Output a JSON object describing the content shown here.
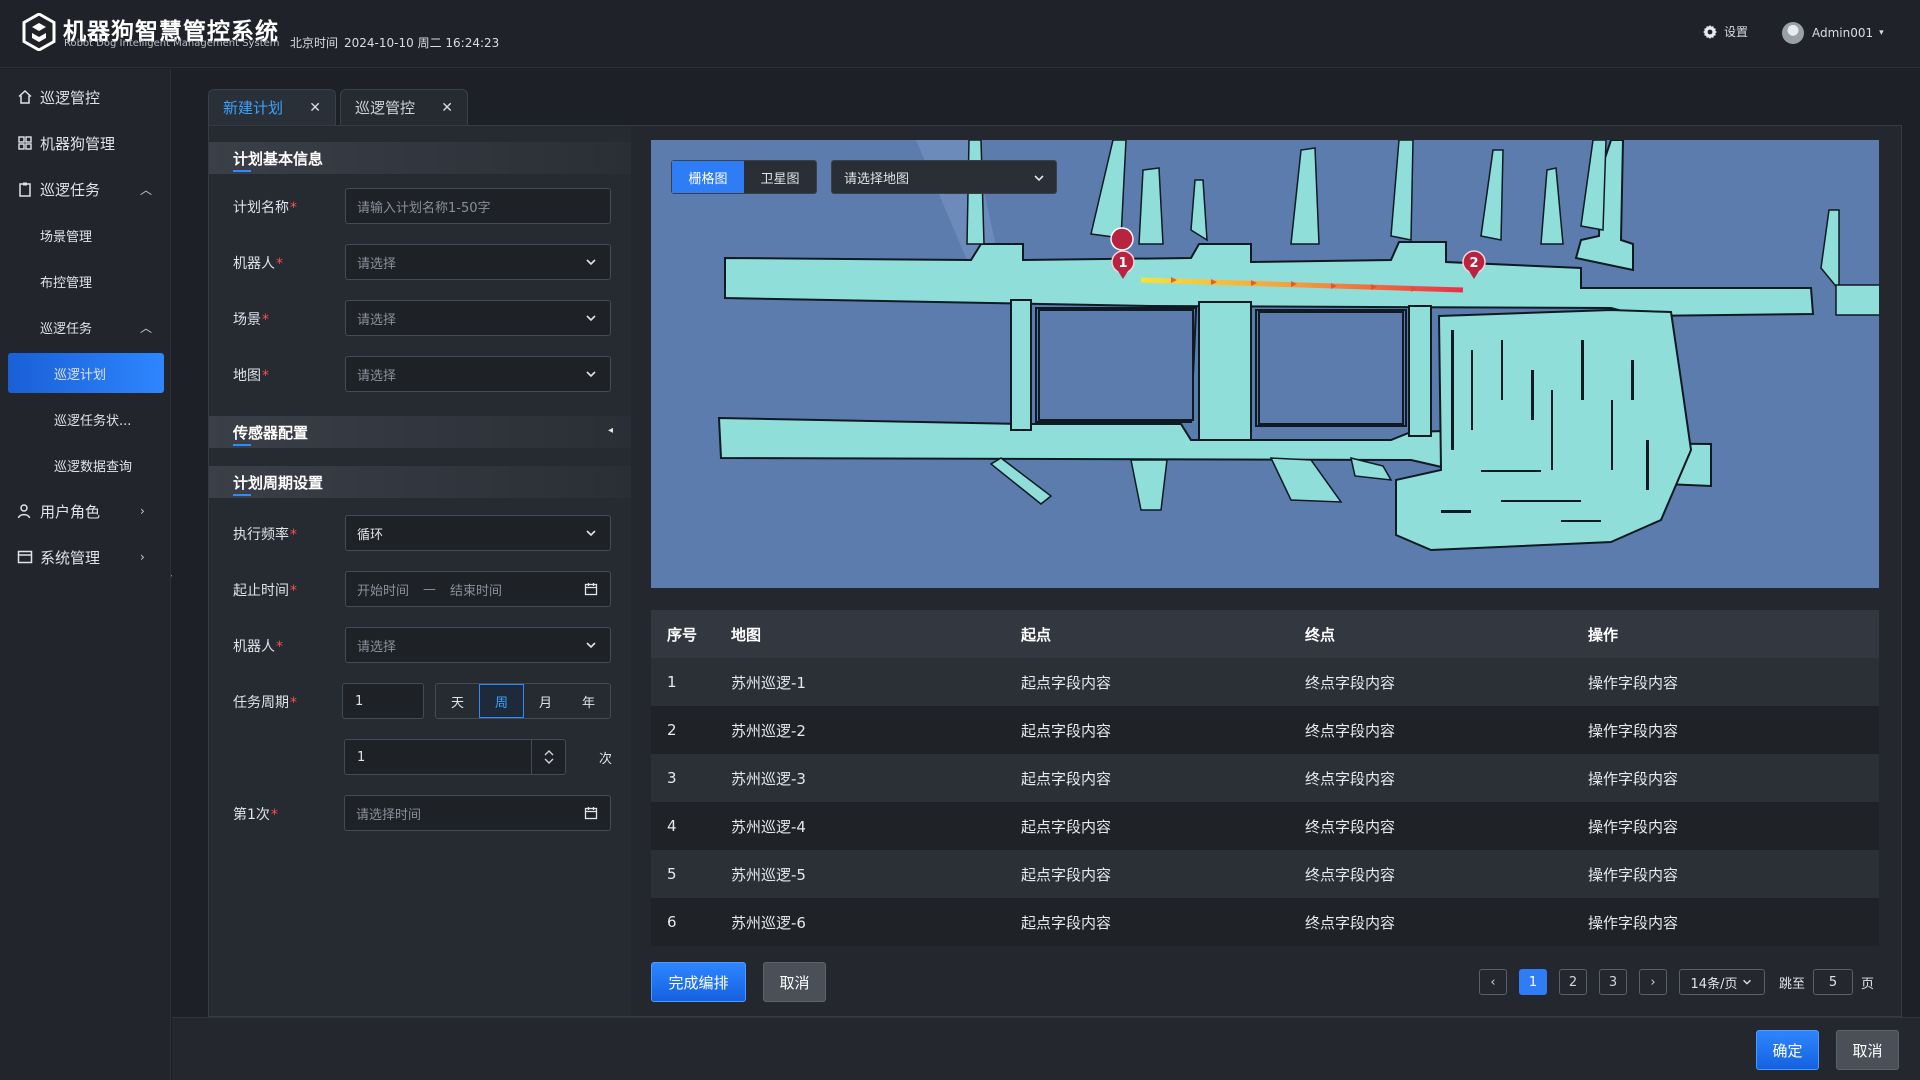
{
  "header": {
    "title": "机器狗智慧管控系统",
    "subtitle": "Robot Dog Intelligent Management System",
    "clock_label": "北京时间",
    "clock_value": "2024-10-10 周二 16:24:23",
    "settings_label": "设置",
    "user_name": "Admin001",
    "user_caret": "▾"
  },
  "sidebar": {
    "items": [
      {
        "label": "巡逻管控",
        "icon": "home-icon"
      },
      {
        "label": "机器狗管理",
        "icon": "grid-icon"
      },
      {
        "label": "巡逻任务",
        "icon": "clipboard-icon",
        "arrow": "︿"
      },
      {
        "label": "场景管理"
      },
      {
        "label": "布控管理"
      },
      {
        "label": "巡逻任务",
        "arrow": "︿"
      },
      {
        "label": "巡逻计划"
      },
      {
        "label": "巡逻任务状..."
      },
      {
        "label": "巡逻数据查询"
      },
      {
        "label": "用户角色",
        "icon": "user-icon",
        "arrow": "›"
      },
      {
        "label": "系统管理",
        "icon": "window-icon",
        "arrow": "›"
      }
    ],
    "collapse_glyph": "«"
  },
  "tabs": [
    {
      "label": "新建计划",
      "close": "✕"
    },
    {
      "label": "巡逻管控",
      "close": "✕"
    }
  ],
  "form": {
    "section_basic": "计划基本信息",
    "section_sensor": "传感器配置",
    "section_sensor_chev": "◂",
    "section_period": "计划周期设置",
    "required_mark": "*",
    "plan_name_label": "计划名称",
    "plan_name_placeholder": "请输入计划名称1-50字",
    "robot_label": "机器人",
    "robot_placeholder": "请选择",
    "scene_label": "场景",
    "scene_placeholder": "请选择",
    "map_label": "地图",
    "map_placeholder": "请选择",
    "freq_label": "执行频率",
    "freq_value": "循环",
    "range_label": "起止时间",
    "range_start": "开始时间",
    "range_dash": "—",
    "range_end": "结束时间",
    "robot2_label": "机器人",
    "robot2_placeholder": "请选择",
    "period_label": "任务周期",
    "period_value": "1",
    "period_units": [
      "天",
      "周",
      "月",
      "年"
    ],
    "period_selected": "周",
    "count_value": "1",
    "count_unit": "次",
    "first_label": "第1次",
    "first_placeholder": "请选择时间"
  },
  "map": {
    "modes": [
      "栅格图",
      "卫星图"
    ],
    "mode_selected": "栅格图",
    "select_placeholder": "请选择地图",
    "markers": [
      "1",
      "2"
    ],
    "colors": {
      "background": "#5b7cad",
      "floor": "#8fded9",
      "route_start": "#f6e23a",
      "route_end": "#e8304a",
      "marker": "#b8233f"
    }
  },
  "table": {
    "headers": [
      "序号",
      "地图",
      "起点",
      "终点",
      "操作"
    ],
    "rows": [
      [
        "1",
        "苏州巡逻-1",
        "起点字段内容",
        "终点字段内容",
        "操作字段内容"
      ],
      [
        "2",
        "苏州巡逻-2",
        "起点字段内容",
        "终点字段内容",
        "操作字段内容"
      ],
      [
        "3",
        "苏州巡逻-3",
        "起点字段内容",
        "终点字段内容",
        "操作字段内容"
      ],
      [
        "4",
        "苏州巡逻-4",
        "起点字段内容",
        "终点字段内容",
        "操作字段内容"
      ],
      [
        "5",
        "苏州巡逻-5",
        "起点字段内容",
        "终点字段内容",
        "操作字段内容"
      ],
      [
        "6",
        "苏州巡逻-6",
        "起点字段内容",
        "终点字段内容",
        "操作字段内容"
      ]
    ]
  },
  "actions": {
    "finish": "完成编排",
    "cancel": "取消",
    "confirm": "确定",
    "cancel2": "取消"
  },
  "pagination": {
    "prev": "‹",
    "pages": [
      "1",
      "2",
      "3"
    ],
    "current": "1",
    "next": "›",
    "page_size": "14条/页",
    "jump_label": "跳至",
    "jump_value": "5",
    "page_unit": "页"
  }
}
